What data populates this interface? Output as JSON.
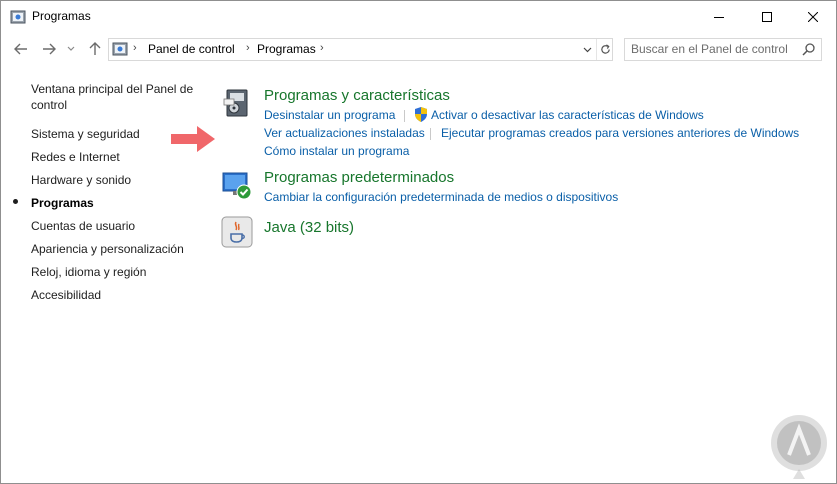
{
  "window": {
    "title": "Programas"
  },
  "address": {
    "breadcrumb": [
      "Panel de control",
      "Programas"
    ]
  },
  "search": {
    "placeholder": "Buscar en el Panel de control"
  },
  "sidebar": {
    "items": [
      {
        "label_line1": "Ventana principal del Panel de",
        "label_line2": "control"
      },
      {
        "label": "Sistema y seguridad"
      },
      {
        "label": "Redes e Internet"
      },
      {
        "label": "Hardware y sonido"
      },
      {
        "label": "Programas",
        "active": true
      },
      {
        "label": "Cuentas de usuario"
      },
      {
        "label": "Apariencia y personalización"
      },
      {
        "label": "Reloj, idioma y región"
      },
      {
        "label": "Accesibilidad"
      }
    ]
  },
  "categories": [
    {
      "title": "Programas y características",
      "links": [
        "Desinstalar un programa",
        "Activar o desactivar las características de Windows",
        "Ver actualizaciones instaladas",
        "Ejecutar programas creados para versiones anteriores de Windows",
        "Cómo instalar un programa"
      ],
      "icon": "programs-features-icon"
    },
    {
      "title": "Programas predeterminados",
      "links": [
        "Cambiar la configuración predeterminada de medios o dispositivos"
      ],
      "icon": "default-programs-icon"
    },
    {
      "title": "Java (32 bits)",
      "links": [],
      "icon": "java-icon"
    }
  ],
  "colors": {
    "category_title": "#17762c",
    "link": "#0a5fa8",
    "arrow": "#f0676a"
  }
}
